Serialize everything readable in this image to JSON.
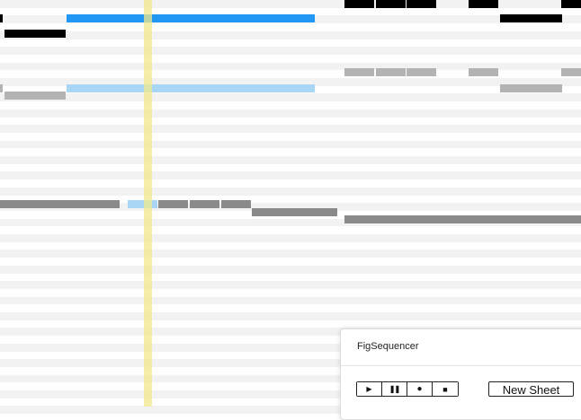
{
  "colors": {
    "lane_light": "#f2f2f2",
    "lane_white": "#ffffff",
    "note_black": "#000000",
    "note_blue": "#2196f3",
    "note_light_blue": "#a9d6f5",
    "note_gray": "#b3b3b3",
    "note_dark_gray": "#8a8a8a",
    "playhead": "#f2e88c"
  },
  "sequencer": {
    "panel_title": "FigSequencer",
    "transport": {
      "play_icon": "play-icon",
      "pause_icon": "pause-icon",
      "record_icon": "record-icon",
      "stop_icon": "stop-icon"
    },
    "new_sheet_label": "New Sheet"
  }
}
